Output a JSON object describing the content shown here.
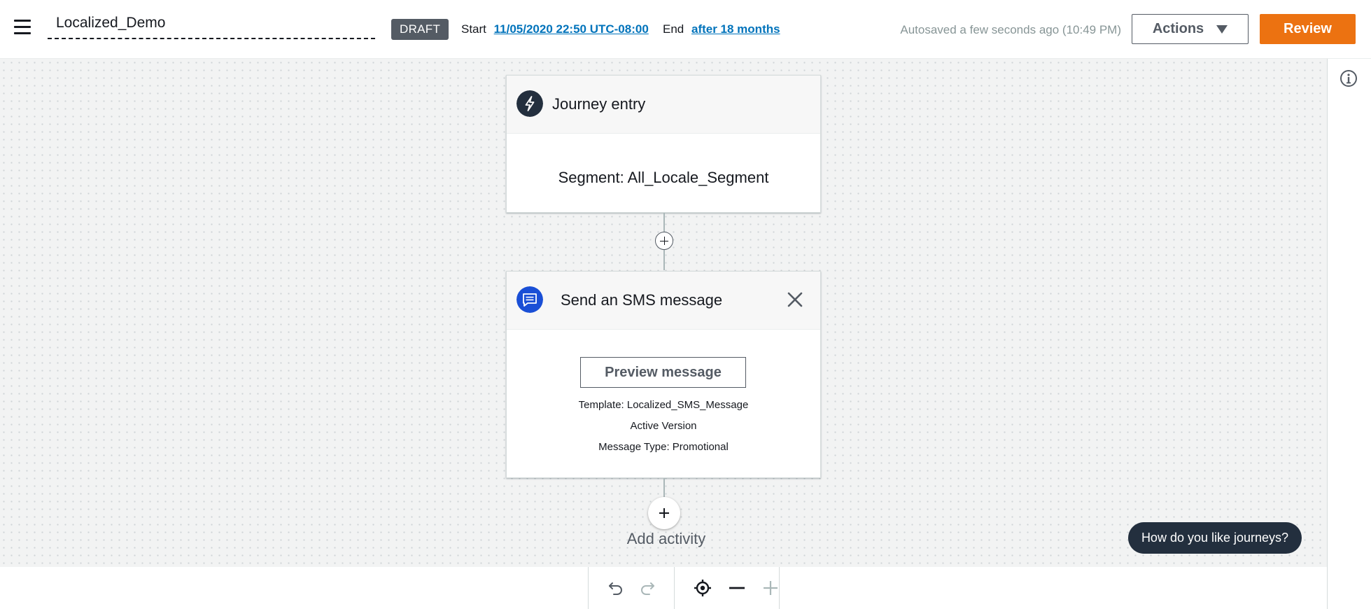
{
  "header": {
    "journey_name": "Localized_Demo",
    "status_badge": "DRAFT",
    "start_label": "Start",
    "start_value": "11/05/2020 22:50 UTC-08:00",
    "end_label": "End",
    "end_value": "after 18 months",
    "autosave_text": "Autosaved a few seconds ago (10:49 PM)",
    "actions_label": "Actions",
    "review_label": "Review"
  },
  "canvas": {
    "entry_card": {
      "title": "Journey entry",
      "segment_text": "Segment: All_Locale_Segment",
      "icon": "lightning-icon"
    },
    "sms_card": {
      "title": "Send an SMS message",
      "preview_button": "Preview message",
      "template_text": "Template: Localized_SMS_Message",
      "version_text": "Active Version",
      "message_type_text": "Message Type: Promotional",
      "icon": "chat-icon"
    },
    "add_activity_label": "Add activity"
  },
  "feedback_label": "How do you like journeys?",
  "toolbar": {
    "icons": [
      "undo-icon",
      "redo-icon",
      "recenter-icon",
      "zoom-out-icon",
      "zoom-in-icon"
    ]
  },
  "colors": {
    "accent_orange": "#ec7211",
    "link_blue": "#0073bb",
    "badge_gray": "#545b64",
    "entry_icon_bg": "#232f3e",
    "sms_icon_bg": "#1a4fd6",
    "feedback_bg": "#232f3e"
  }
}
